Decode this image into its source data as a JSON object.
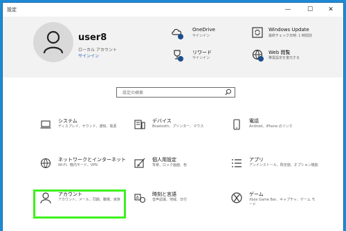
{
  "window": {
    "title": "設定",
    "minimize": "—",
    "maximize": "☐",
    "close": "✕"
  },
  "user": {
    "name": "user8",
    "account_type": "ローカル アカウント",
    "signin_link": "サインイン"
  },
  "header_items": [
    {
      "name": "onedrive",
      "icon": "cloud-icon",
      "title": "OneDrive",
      "subtitle": "サインイン"
    },
    {
      "name": "windows-update",
      "icon": "update-icon",
      "title": "Windows Update",
      "subtitle": "最終チェック日時: 1 時間前"
    },
    {
      "name": "rewards",
      "icon": "trophy-icon",
      "title": "リワード",
      "subtitle": "サインイン"
    },
    {
      "name": "web-browsing",
      "icon": "globe-icon",
      "title": "Web 閲覧",
      "subtitle": "推奨設定を復元する"
    }
  ],
  "search": {
    "placeholder": "設定の検索"
  },
  "tiles": [
    {
      "name": "system",
      "title": "システム",
      "desc": "ディスプレイ、サウンド、通知、電源"
    },
    {
      "name": "devices",
      "title": "デバイス",
      "desc": "Bluetooth、プリンター、マウス"
    },
    {
      "name": "phone",
      "title": "電話",
      "desc": "Android、iPhone のリンク"
    },
    {
      "name": "network",
      "title": "ネットワークとインターネット",
      "desc": "Wi-Fi、機内モード、VPN"
    },
    {
      "name": "personalization",
      "title": "個人用設定",
      "desc": "背景、ロック画面、色"
    },
    {
      "name": "apps",
      "title": "アプリ",
      "desc": "アンインストール、既定値、オプション機能"
    },
    {
      "name": "accounts",
      "title": "アカウント",
      "desc": "アカウント、メール、同期、職場、家族"
    },
    {
      "name": "time-language",
      "title": "時刻と言語",
      "desc": "音声認識、地域、日付"
    },
    {
      "name": "gaming",
      "title": "ゲーム",
      "desc": "Xbox Game Bar、キャプチャ、ゲーム モード"
    }
  ]
}
